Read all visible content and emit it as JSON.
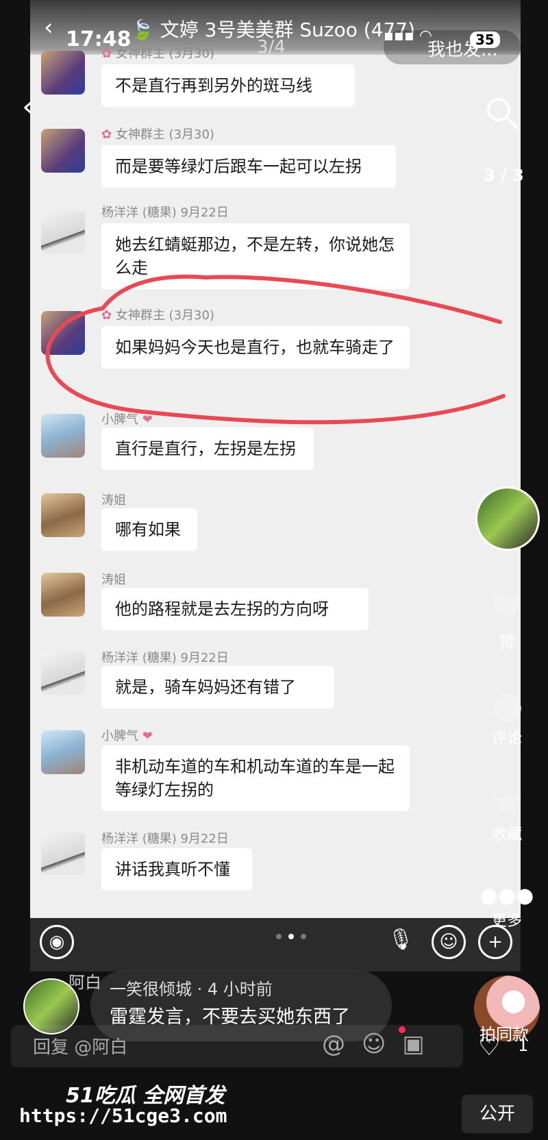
{
  "status_bar": {
    "time": "17:48",
    "battery": "35"
  },
  "chat_header": {
    "title": "🍃 文婷 3号美美群 Suzoo (477)",
    "page_counter": "3/4"
  },
  "overlay_top": {
    "pill_label": "我也发...",
    "side_counter": "3 / 3"
  },
  "messages": [
    {
      "sender": "女神群主 (3月30)",
      "text": "不是直行再到另外的斑马线"
    },
    {
      "sender": "女神群主 (3月30)",
      "text": "而是要等绿灯后跟车一起可以左拐"
    },
    {
      "sender": "杨洋洋 (糖果) 9月22日",
      "text": "她去红蜻蜓那边，不是左转，你说她怎么走"
    },
    {
      "sender": "女神群主 (3月30)",
      "text": "如果妈妈今天也是直行，也就车骑走了"
    },
    {
      "sender": "小脾气",
      "text": "直行是直行，左拐是左拐"
    },
    {
      "sender": "涛姐",
      "text": "哪有如果"
    },
    {
      "sender": "涛姐",
      "text": "他的路程就是去左拐的方向呀"
    },
    {
      "sender": "杨洋洋 (糖果) 9月22日",
      "text": "就是，骑车妈妈还有错了"
    },
    {
      "sender": "小脾气",
      "text": "非机动车道的车和机动车道的车是一起等绿灯左拐的"
    },
    {
      "sender": "杨洋洋 (糖果) 9月22日",
      "text": "讲话我真听不懂"
    }
  ],
  "rail": {
    "like_label": "赞",
    "comment_label": "评论",
    "favorite_label": "收藏",
    "more_label": "更多",
    "same_label": "拍同款",
    "like_count": "1"
  },
  "comment": {
    "author": "一笑很倾城 · 4 小时前",
    "text": "雷霆发言，不要去买她东西了",
    "side_label": "阿白"
  },
  "reply": {
    "placeholder": "回复 @阿白"
  },
  "watermark": {
    "brand": "51吃瓜 全网首发",
    "url": "https://51cge3.com"
  },
  "bottom": {
    "public_label": "公开"
  },
  "colors": {
    "annotation_red": "#e84a55",
    "bubble": "#ffffff",
    "chat_bg": "#efefef"
  }
}
